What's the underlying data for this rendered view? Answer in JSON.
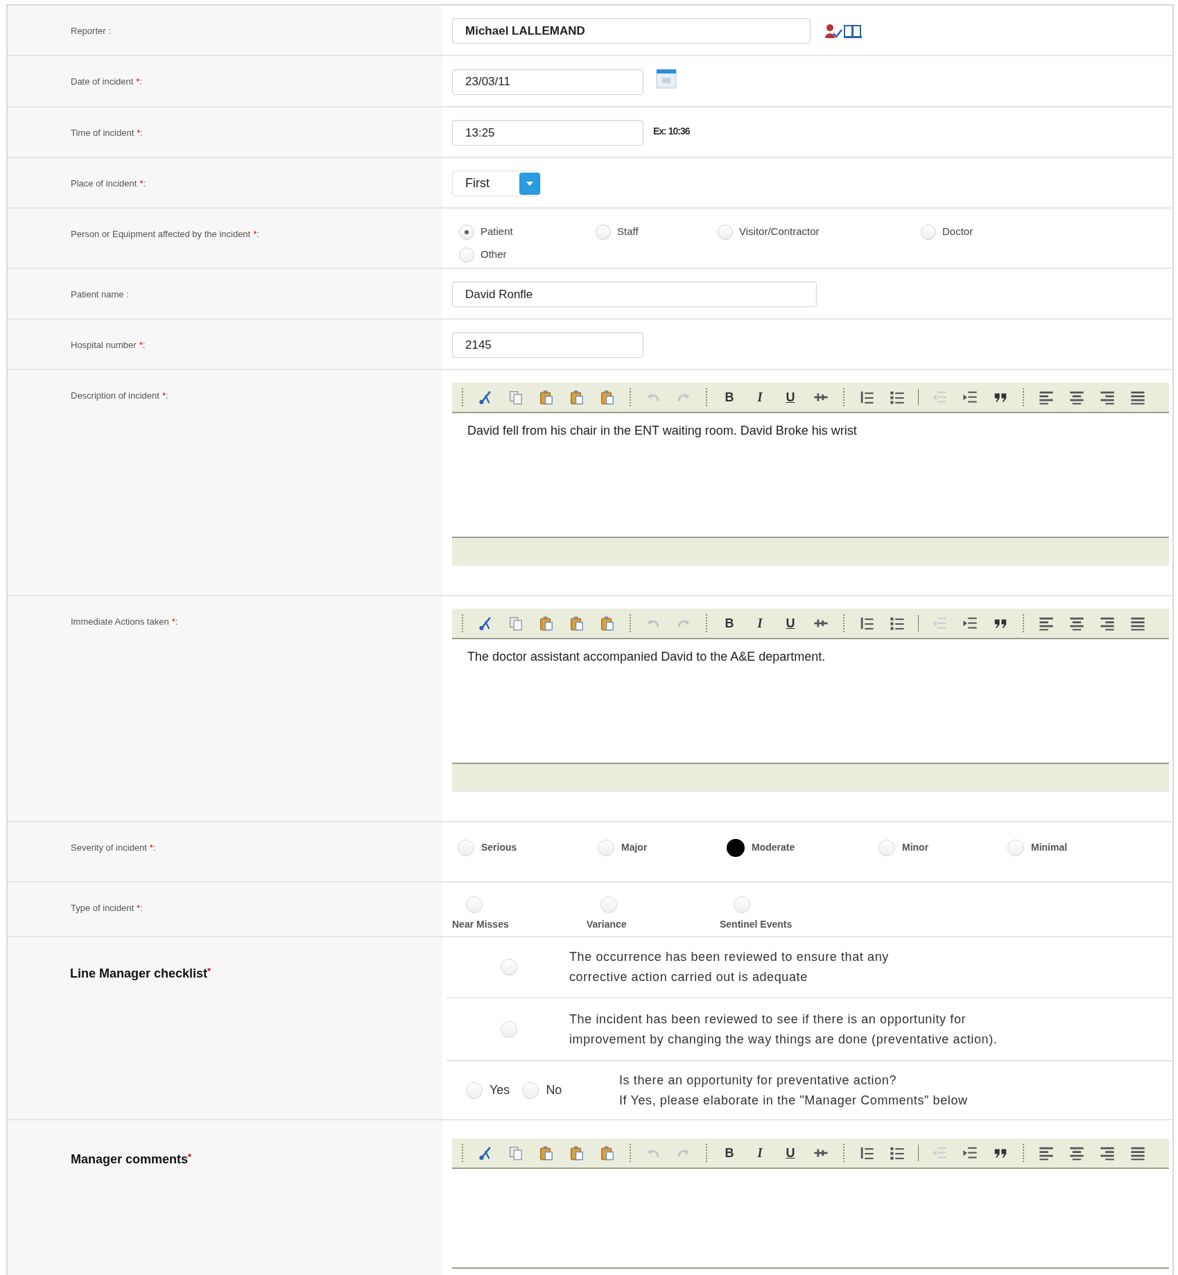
{
  "rows": [
    {
      "kind": "reporter",
      "label": "Reporter :",
      "value": "Michael LALLEMAND"
    },
    {
      "kind": "date",
      "label": "Date of incident",
      "required_mark": "*",
      "colon": ":",
      "value": "23/03/11"
    },
    {
      "kind": "time",
      "label": "Time of incident",
      "required_mark": "*",
      "colon": ":",
      "value": "13:25",
      "hint": "Ex: 10:36"
    },
    {
      "kind": "select",
      "label": "Place of incident",
      "required_mark": "*",
      "colon": ":",
      "value": "First"
    },
    {
      "kind": "radio_grid",
      "label": "Person or Equipment affected by the incident",
      "required_mark": "*",
      "colon": ":",
      "options": [
        {
          "label": "Patient",
          "selected": true
        },
        {
          "label": "Staff",
          "selected": false
        },
        {
          "label": "Visitor/Contractor",
          "selected": false
        },
        {
          "label": "Doctor",
          "selected": false
        },
        {
          "label": "Other",
          "selected": false
        }
      ]
    },
    {
      "kind": "name_field",
      "label": "Patient name :",
      "value": "David Ronfle"
    },
    {
      "kind": "number_field",
      "label": "Hospital number",
      "required_mark": "*",
      "colon": ":",
      "value": "2145"
    },
    {
      "kind": "editor",
      "label": "Description of incident",
      "required_mark": "*",
      "colon": ":",
      "toolbar_labels": [
        "B",
        "I",
        "U"
      ],
      "text": "David fell from his chair in the ENT waiting room. David Broke his wrist",
      "footer": true
    },
    {
      "kind": "editor",
      "label": "Immediate Actions taken",
      "required_mark": "*",
      "colon": ":",
      "toolbar_labels": [
        "B",
        "I",
        "U"
      ],
      "text": "The doctor assistant accompanied David to the A&E department.",
      "footer": true
    },
    {
      "kind": "radio_row",
      "label": "Severity of incident",
      "required_mark": "*",
      "colon": ":",
      "options": [
        {
          "label": "Serious",
          "selected": false
        },
        {
          "label": "Major",
          "selected": false
        },
        {
          "label": "Moderate",
          "selected": true
        },
        {
          "label": "Minor",
          "selected": false
        },
        {
          "label": "Minimal",
          "selected": false
        }
      ]
    },
    {
      "kind": "radio_stack",
      "label": "Type of incident",
      "required_mark": "*",
      "colon": ":",
      "options": [
        {
          "label": "Near Misses",
          "selected": false
        },
        {
          "label": "Variance",
          "selected": false
        },
        {
          "label": "Sentinel Events",
          "selected": false
        }
      ]
    },
    {
      "kind": "checklist",
      "heading": true,
      "label": "Line Manager checklist",
      "required_mark": "*",
      "items": [
        {
          "kind": "check",
          "selected": false,
          "lines": [
            "The occurrence has been reviewed to ensure that any",
            "corrective action carried out is adequate"
          ]
        },
        {
          "kind": "check",
          "selected": false,
          "lines": [
            "The incident has been reviewed to see if there is an opportunity for",
            "improvement by changing the way things are done (preventative action)."
          ]
        },
        {
          "kind": "yes_no",
          "options": [
            {
              "label": "Yes",
              "selected": false
            },
            {
              "label": "No",
              "selected": false
            }
          ],
          "lines": [
            "Is there an opportunity for preventative action?",
            "If Yes, please elaborate in the \"Manager Comments\" below"
          ]
        }
      ]
    },
    {
      "kind": "editor",
      "heading": true,
      "label": "Manager comments",
      "required_mark": "*",
      "toolbar_labels": [
        "B",
        "I",
        "U"
      ],
      "footer": false
    }
  ]
}
